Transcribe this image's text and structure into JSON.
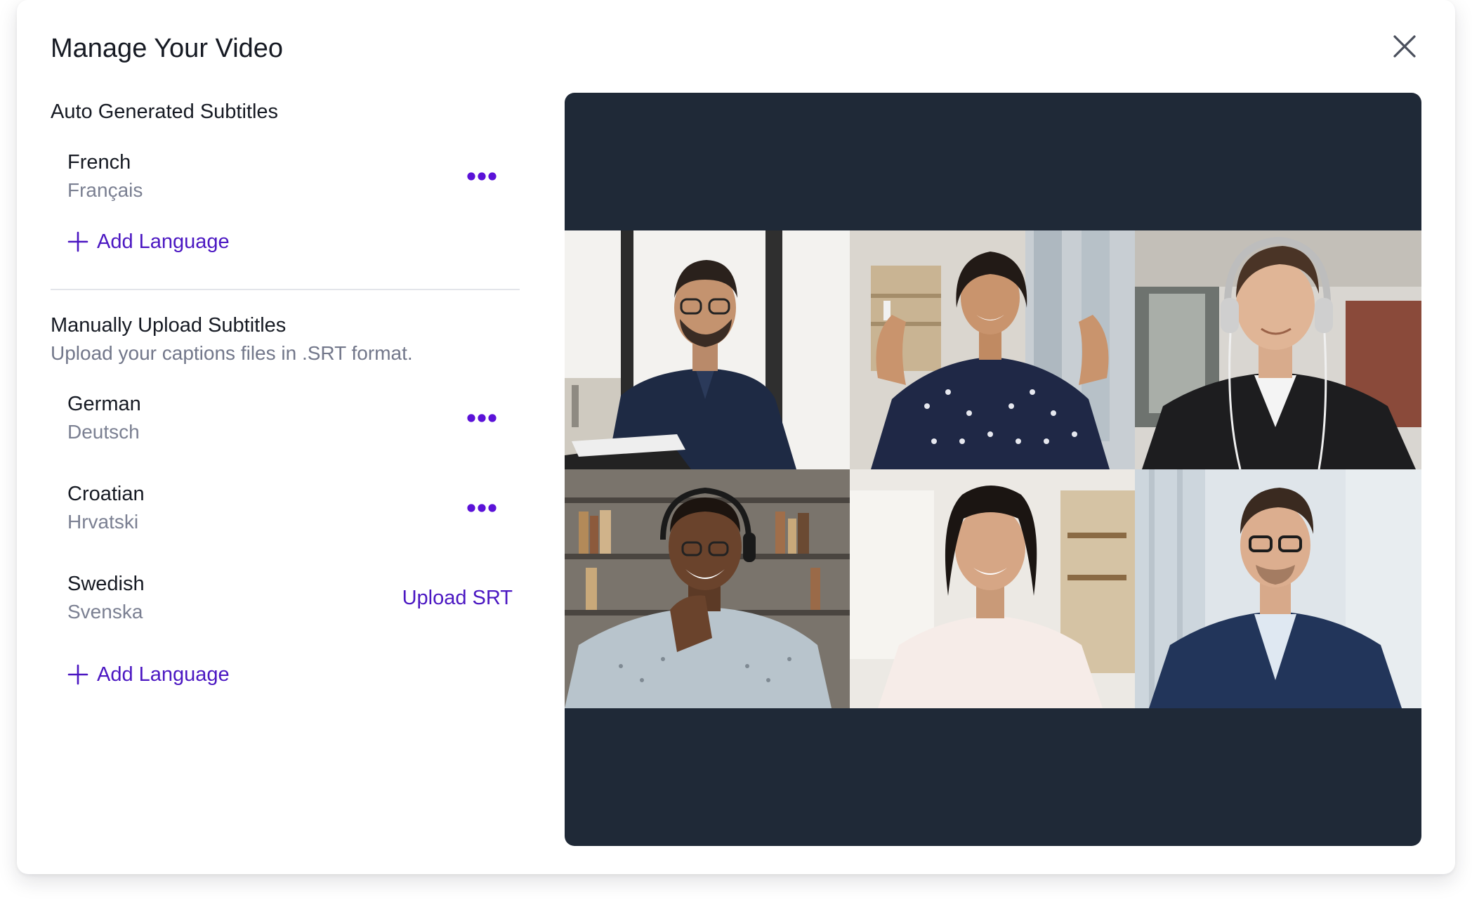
{
  "dialog": {
    "title": "Manage Your Video",
    "close_icon": "close-icon"
  },
  "auto_section": {
    "title": "Auto Generated Subtitles",
    "languages": [
      {
        "name": "French",
        "native": "Français",
        "action": "more-options"
      }
    ],
    "add_label": "Add Language"
  },
  "manual_section": {
    "title": "Manually Upload Subtitles",
    "subtitle": "Upload your captions files in .SRT format.",
    "languages": [
      {
        "name": "German",
        "native": "Deutsch",
        "action": "more-options"
      },
      {
        "name": "Croatian",
        "native": "Hrvatski",
        "action": "more-options"
      },
      {
        "name": "Swedish",
        "native": "Svenska",
        "action": "Upload SRT"
      }
    ],
    "add_label": "Add Language"
  },
  "video_preview": {
    "background": "#1f2937",
    "participants": 6
  },
  "colors": {
    "accent": "#4b17c2",
    "dots": "#5b12d8",
    "text_primary": "#161a23",
    "text_secondary": "#7b8092"
  }
}
